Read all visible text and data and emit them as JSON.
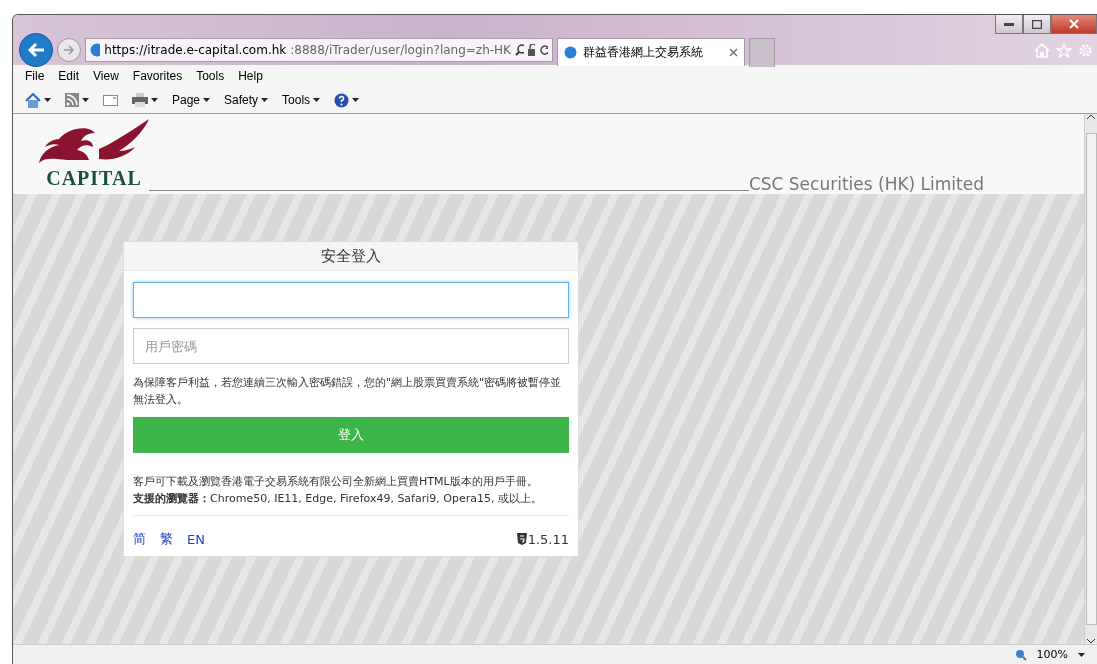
{
  "browser": {
    "url_host": "https://itrade.e-capital.com.hk",
    "url_path": ":8888/iTrader/user/login?lang=zh-HK",
    "tabs": [
      {
        "title": "群益香港網上交易系統",
        "selected": true
      }
    ],
    "menu": [
      "File",
      "Edit",
      "View",
      "Favorites",
      "Tools",
      "Help"
    ],
    "commands": [
      "Page",
      "Safety",
      "Tools"
    ],
    "zoom": "100%"
  },
  "page": {
    "logo_text": "CAPITAL",
    "company": "CSC Securities (HK) Limited",
    "login": {
      "title": "安全登入",
      "username": {
        "focused": true
      },
      "password": {
        "placeholder": "用戶密碼",
        "focused": false
      },
      "warning": "為保障客戶利益，若您連續三次輸入密碼錯誤，您的\"網上股票買賣系統\"密碼將被暫停並無法登入。",
      "submit": "登入",
      "info": "客戶可下載及瀏覽香港電子交易系統有限公司全新網上買賣HTML版本的用戶手冊。",
      "browsers": "**支援的瀏覽器：**Chrome50, IE11, Edge, Firefox49, Safari9, Opera15, 或以上。",
      "languages": [
        {
          "label": "简",
          "selected": false
        },
        {
          "label": "繁",
          "selected": false
        },
        {
          "label": "EN",
          "selected": false
        }
      ],
      "version": "1.5.11"
    }
  }
}
